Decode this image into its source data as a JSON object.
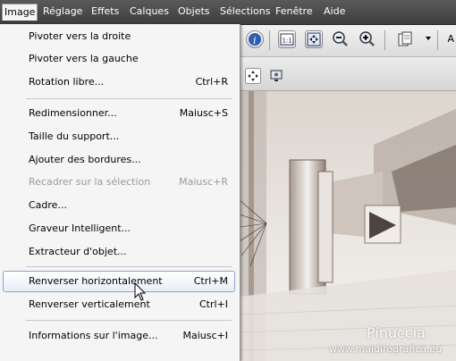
{
  "menubar": {
    "items": [
      "Image",
      "Réglage",
      "Effets",
      "Calques",
      "Objets",
      "Sélections",
      "Fenêtre",
      "Aide"
    ],
    "active": "Image"
  },
  "toolbar": {
    "cut_label": "A"
  },
  "menu": {
    "items": [
      {
        "label": "Pivoter vers la droite",
        "shortcut": "",
        "state": "normal"
      },
      {
        "label": "Pivoter vers la gauche",
        "shortcut": "",
        "state": "normal"
      },
      {
        "label": "Rotation libre...",
        "shortcut": "Ctrl+R",
        "state": "normal"
      },
      {
        "label": "Redimensionner...",
        "shortcut": "Maiusc+S",
        "state": "normal"
      },
      {
        "label": "Taille du support...",
        "shortcut": "",
        "state": "normal"
      },
      {
        "label": "Ajouter des bordures...",
        "shortcut": "",
        "state": "normal"
      },
      {
        "label": "Recadrer sur la sélection",
        "shortcut": "Maiusc+R",
        "state": "disabled"
      },
      {
        "label": "Cadre...",
        "shortcut": "",
        "state": "normal"
      },
      {
        "label": "Graveur Intelligent...",
        "shortcut": "",
        "state": "normal"
      },
      {
        "label": "Extracteur d'objet...",
        "shortcut": "",
        "state": "normal"
      },
      {
        "label": "Renverser horizontalement",
        "shortcut": "Ctrl+M",
        "state": "hover"
      },
      {
        "label": "Renverser verticalement",
        "shortcut": "Ctrl+I",
        "state": "normal"
      },
      {
        "label": "Informations sur l'image...",
        "shortcut": "Maiusc+I",
        "state": "normal"
      }
    ]
  },
  "watermark": {
    "name": "Pinuccia",
    "site": "www.maidiregrafica.eu"
  },
  "icons": [
    "info-icon",
    "actual-size-icon",
    "fit-window-icon",
    "zoom-out-icon",
    "zoom-in-icon",
    "clipboard-icon",
    "move-icon",
    "screenshot-icon"
  ]
}
